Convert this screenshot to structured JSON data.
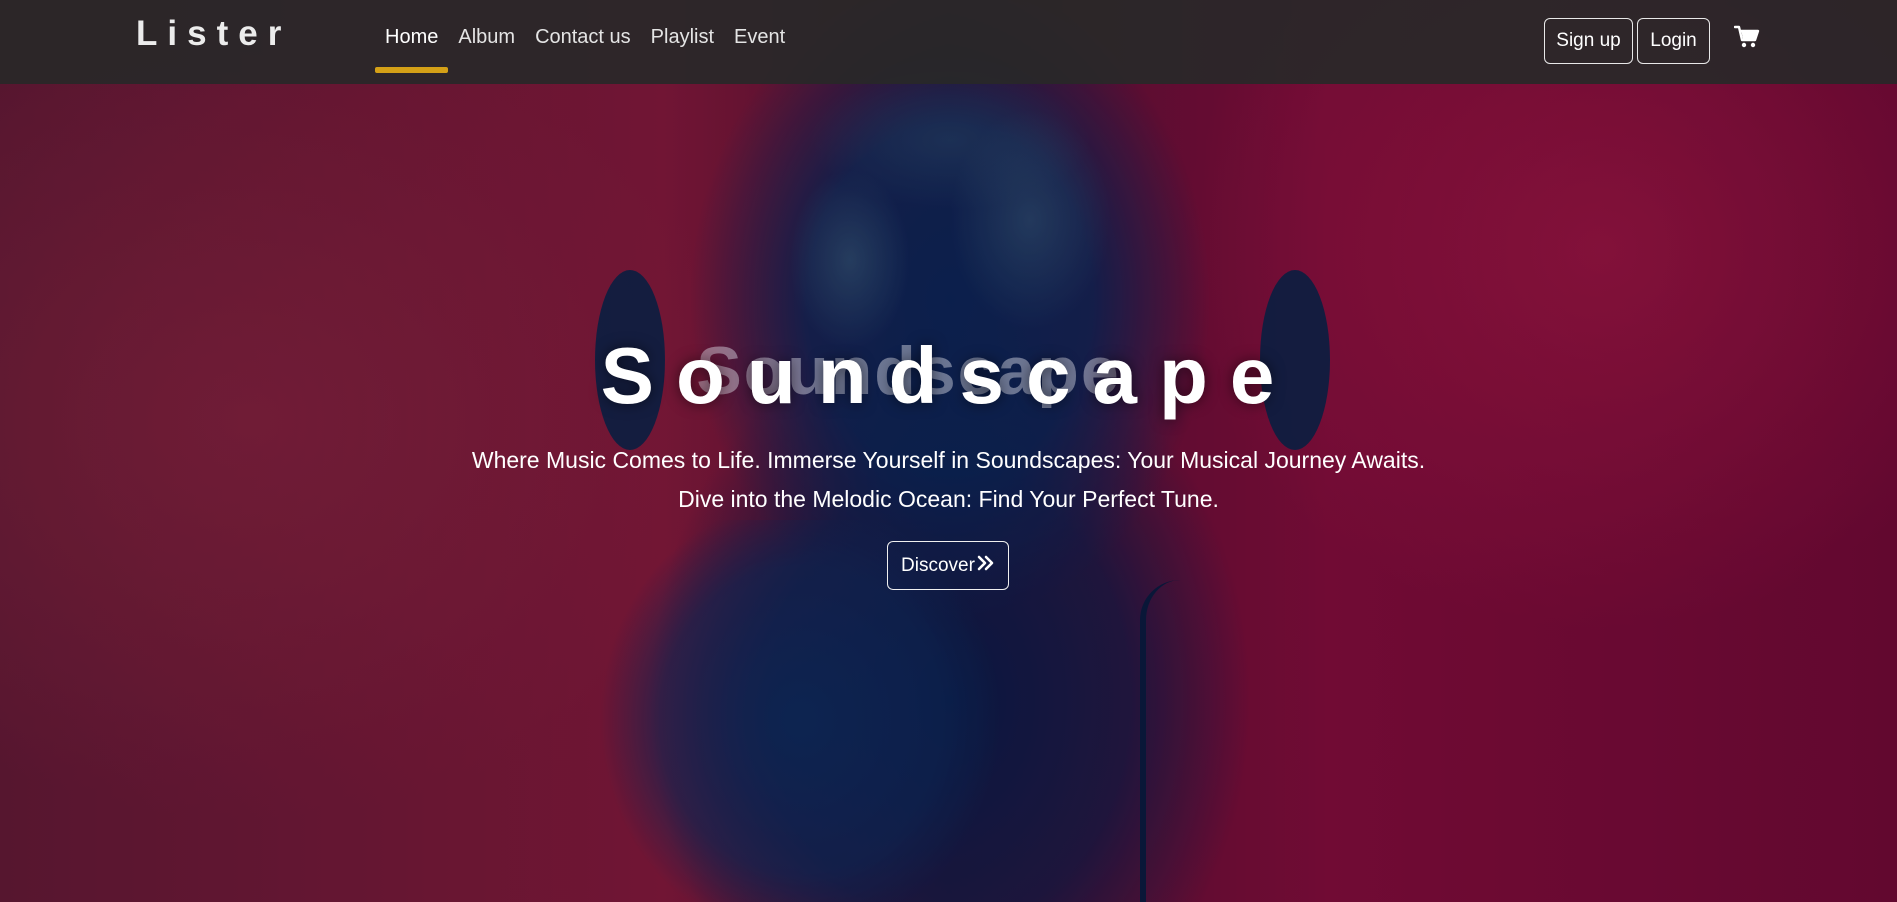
{
  "brand": "Lister",
  "nav": {
    "items": [
      {
        "label": "Home",
        "active": true
      },
      {
        "label": "Album",
        "active": false
      },
      {
        "label": "Contact us",
        "active": false
      },
      {
        "label": "Playlist",
        "active": false
      },
      {
        "label": "Event",
        "active": false
      }
    ],
    "active_underline_color": "#d4a017"
  },
  "auth": {
    "signup_label": "Sign up",
    "login_label": "Login"
  },
  "cart_icon": "shopping-cart-icon",
  "hero": {
    "title": "Soundscape",
    "subtitle": "Where Music Comes to Life. Immerse Yourself in Soundscapes: Your Musical Journey Awaits. Dive into the Melodic Ocean: Find Your Perfect Tune.",
    "cta_label": "Discover",
    "cta_icon": "double-chevron-right-icon"
  }
}
